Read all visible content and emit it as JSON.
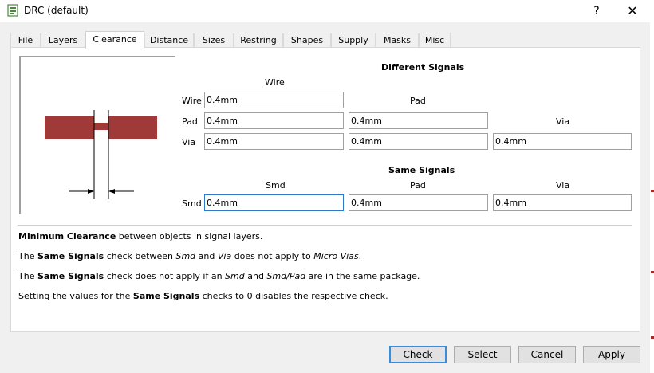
{
  "window": {
    "title": "DRC (default)",
    "help_label": "?",
    "close_label": "✕"
  },
  "tabs": [
    {
      "label": "File"
    },
    {
      "label": "Layers"
    },
    {
      "label": "Clearance",
      "active": true
    },
    {
      "label": "Distance"
    },
    {
      "label": "Sizes"
    },
    {
      "label": "Restring"
    },
    {
      "label": "Shapes"
    },
    {
      "label": "Supply"
    },
    {
      "label": "Masks"
    },
    {
      "label": "Misc"
    }
  ],
  "clearance": {
    "different_heading": "Different Signals",
    "same_heading": "Same Signals",
    "col_wire": "Wire",
    "col_pad": "Pad",
    "col_via": "Via",
    "col_smd": "Smd",
    "row_wire": "Wire",
    "row_pad": "Pad",
    "row_via": "Via",
    "row_smd": "Smd",
    "wire_wire": "0.4mm",
    "pad_wire": "0.4mm",
    "pad_pad": "0.4mm",
    "via_wire": "0.4mm",
    "via_pad": "0.4mm",
    "via_via": "0.4mm",
    "smd_smd": "0.4mm",
    "smd_pad": "0.4mm",
    "smd_via": "0.4mm"
  },
  "info": {
    "line1": {
      "b1": "Minimum Clearance",
      "t1": " between objects in signal layers."
    },
    "line2": {
      "t1": "The ",
      "b1": "Same Signals",
      "t2": " check between ",
      "i1": "Smd",
      "t3": " and ",
      "i2": "Via",
      "t4": " does not apply to ",
      "i3": "Micro Vias",
      "t5": "."
    },
    "line3": {
      "t1": "The ",
      "b1": "Same Signals",
      "t2": " check does not apply if an ",
      "i1": "Smd",
      "t3": " and ",
      "i2": "Smd/Pad",
      "t4": " are in the same package."
    },
    "line4": {
      "t1": "Setting the values for the ",
      "b1": "Same Signals",
      "t2": " checks to 0 disables the respective check."
    }
  },
  "buttons": {
    "check": "Check",
    "select": "Select",
    "cancel": "Cancel",
    "apply": "Apply"
  },
  "colors": {
    "copper": "#a03a38",
    "focus_border": "#2f79c8",
    "default_button_border": "#3a8bd9"
  }
}
